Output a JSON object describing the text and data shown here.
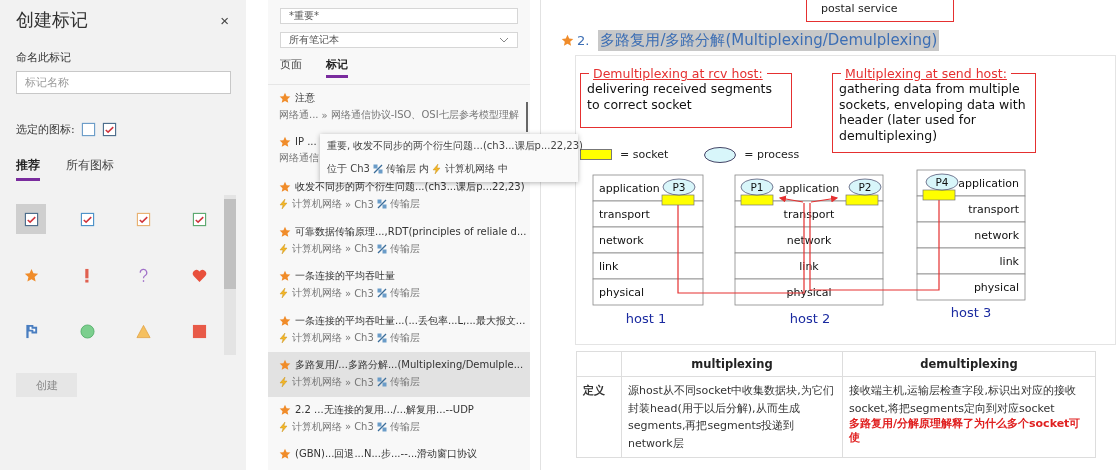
{
  "create_tag_panel": {
    "title": "创建标记",
    "close": "×",
    "name_label": "命名此标记",
    "name_field": {
      "placeholder": "标记名称"
    },
    "selected_icon_label": "选定的图标:",
    "selected_icons": [
      {
        "kind": "empty-box"
      },
      {
        "kind": "checkbox",
        "color": "#4a6b8a"
      }
    ],
    "tabs": [
      {
        "label": "推荐",
        "selected": true
      },
      {
        "label": "所有图标",
        "selected": false
      }
    ],
    "icons": [
      {
        "kind": "checkbox",
        "color": "#4a6b8a",
        "selected": true
      },
      {
        "kind": "checkbox",
        "color": "#4a90c8",
        "selected": false
      },
      {
        "kind": "checkbox",
        "color": "#e8b070",
        "selected": false
      },
      {
        "kind": "checkbox",
        "color": "#5aa86e",
        "selected": false
      },
      {
        "kind": "star",
        "color": "#f08c2a",
        "selected": false
      },
      {
        "kind": "exclamation",
        "color": "#e06050",
        "selected": false
      },
      {
        "kind": "question",
        "color": "#a070c8",
        "selected": false
      },
      {
        "kind": "heart",
        "color": "#e8503c",
        "selected": false
      },
      {
        "kind": "flag",
        "color": "#4a7ec0",
        "selected": false
      },
      {
        "kind": "circle",
        "color": "#7ccf8e",
        "selected": false
      },
      {
        "kind": "triangle",
        "color": "#f5c060",
        "selected": false
      },
      {
        "kind": "square",
        "color": "#e85a48",
        "selected": false
      }
    ],
    "create_button": {
      "label": "创建",
      "disabled": true
    }
  },
  "tag_search": {
    "search_field": {
      "value": "*重要*"
    },
    "notebook_dropdown": {
      "value": "所有笔记本"
    },
    "tabs": [
      {
        "label": "页面",
        "selected": false
      },
      {
        "label": "标记",
        "selected": true
      }
    ],
    "results": [
      {
        "title": "注意",
        "selected": false,
        "path": [
          {
            "kind": "plain",
            "text": "网络通..."
          },
          {
            "kind": "plain",
            "text": "网络通信协议-ISO、OSI七层参考模型理解",
            "separator": "»"
          }
        ]
      },
      {
        "title": "IP ...",
        "selected": false,
        "path": [
          {
            "kind": "plain",
            "text": "网络通信"
          }
        ]
      },
      {
        "title": "收发不同步的两个衍生问题...(ch3...课后p...22,23)",
        "selected": false,
        "path": [
          {
            "kind": "notebook",
            "text": "计算机网络"
          },
          {
            "kind": "plain",
            "text": "Ch3",
            "separator": "»"
          },
          {
            "kind": "section",
            "text": "传输层"
          }
        ]
      },
      {
        "title": "可靠数据传输原理...,RDT(principles of reliale d...",
        "selected": false,
        "path": [
          {
            "kind": "notebook",
            "text": "计算机网络"
          },
          {
            "kind": "plain",
            "text": "Ch3",
            "separator": "»"
          },
          {
            "kind": "section",
            "text": "传输层"
          }
        ]
      },
      {
        "title": "一条连接的平均吞吐量",
        "selected": false,
        "path": [
          {
            "kind": "notebook",
            "text": "计算机网络"
          },
          {
            "kind": "plain",
            "text": "Ch3",
            "separator": "»"
          },
          {
            "kind": "section",
            "text": "传输层"
          }
        ]
      },
      {
        "title": "一条连接的平均吞吐量...(...丢包率...L,...最大报文...",
        "selected": false,
        "path": [
          {
            "kind": "notebook",
            "text": "计算机网络"
          },
          {
            "kind": "plain",
            "text": "Ch3",
            "separator": "»"
          },
          {
            "kind": "section",
            "text": "传输层"
          }
        ]
      },
      {
        "title": "多路复用/...多路分解...(Multiplexing/Demulple...",
        "selected": true,
        "path": [
          {
            "kind": "notebook",
            "text": "计算机网络"
          },
          {
            "kind": "plain",
            "text": "Ch3",
            "separator": "»"
          },
          {
            "kind": "section",
            "text": "传输层"
          }
        ]
      },
      {
        "title": "2.2 ...无连接的复用.../...解复用...--UDP",
        "selected": false,
        "path": [
          {
            "kind": "notebook",
            "text": "计算机网络"
          },
          {
            "kind": "plain",
            "text": "Ch3",
            "separator": "»"
          },
          {
            "kind": "section",
            "text": "传输层"
          }
        ]
      },
      {
        "title": "(GBN)...回退...N...步...--...滑动窗口协议",
        "selected": false
      }
    ],
    "tooltip": {
      "title": "重要, 收发不同步的两个衍生问题...(ch3...课后p...22,23)",
      "location": [
        {
          "kind": "plain",
          "text": "位于 Ch3"
        },
        {
          "kind": "section",
          "text": "传输层"
        },
        {
          "kind": "plain",
          "text": "内"
        },
        {
          "kind": "notebook",
          "text": "计算机网络"
        },
        {
          "kind": "plain",
          "text": "中"
        }
      ]
    }
  },
  "note": {
    "prev_slide_text": "postal service",
    "heading": {
      "number": "2.",
      "title": "多路复用/多路分解(Multiplexing/Demulplexing)"
    },
    "slide": {
      "boxes": [
        {
          "title": "Demultiplexing at rcv host:",
          "body": "delivering received segments to correct socket"
        },
        {
          "title": "Multiplexing at send host:",
          "body": "gathering data from multiple sockets, enveloping data with header (later used for demultiplexing)"
        }
      ],
      "legend": [
        {
          "kind": "socket",
          "label": "= socket"
        },
        {
          "kind": "process",
          "label": "= process"
        }
      ],
      "hosts": [
        {
          "label": "host 1",
          "layers": [
            "application",
            "transport",
            "network",
            "link",
            "physical"
          ],
          "processes": [
            "P3"
          ]
        },
        {
          "label": "host 2",
          "layers": [
            "application",
            "transport",
            "network",
            "link",
            "physical"
          ],
          "processes": [
            "P1",
            "P2"
          ]
        },
        {
          "label": "host 3",
          "layers": [
            "application",
            "transport",
            "network",
            "link",
            "physical"
          ],
          "processes": [
            "P4"
          ]
        }
      ]
    },
    "table": {
      "columns": [
        "multiplexing",
        "demultiplexing"
      ],
      "rows": [
        {
          "label": "定义",
          "cells": [
            {
              "text": "源host从不同socket中收集数据块,为它们封装head(用于以后分解),从而生成segments,再把segments投递到network层"
            },
            {
              "text": "接收端主机,运输层检查字段,标识出对应的接收socket,将把segments定向到对应socket",
              "note": "多路复用/分解原理解释了为什么多个socket可使"
            }
          ]
        }
      ]
    }
  }
}
